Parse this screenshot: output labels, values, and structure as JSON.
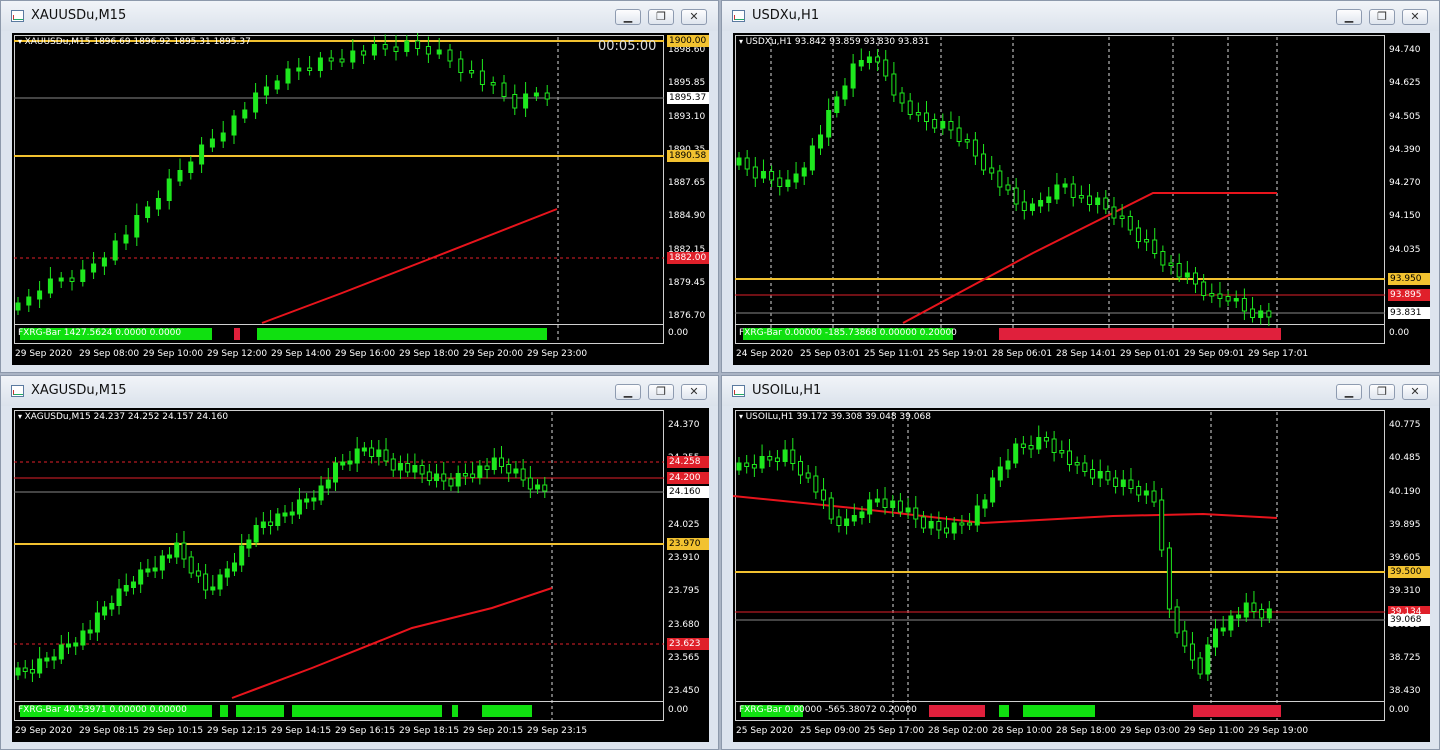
{
  "windows": [
    {
      "title": "XAUUSDu,M15",
      "info": "XAUUSDu,M15  1896.69 1896.92 1895.31 1895.37",
      "timer": "00:05:00",
      "prices": [
        "1898.60",
        "1895.85",
        "1893.10",
        "1890.35",
        "1887.65",
        "1884.90",
        "1882.15",
        "1879.45",
        "1876.70"
      ],
      "tags": [
        {
          "text": "1900.00",
          "bg": "#f2c230",
          "fg": "#000"
        },
        {
          "text": "1895.37",
          "bg": "#fff",
          "fg": "#000"
        },
        {
          "text": "1890.58",
          "bg": "#f2c230",
          "fg": "#000"
        },
        {
          "text": "1882.00",
          "bg": "#e0202a",
          "fg": "#fff"
        }
      ],
      "indicator": "FXRG-Bar 1427.5624 0.0000 0.0000",
      "ind_value": "0.00",
      "dates": [
        "29 Sep 2020",
        "29 Sep 08:00",
        "29 Sep 10:00",
        "29 Sep 12:00",
        "29 Sep 14:00",
        "29 Sep 16:00",
        "29 Sep 18:00",
        "29 Sep 20:00",
        "29 Sep 23:00"
      ]
    },
    {
      "title": "USDXu,H1",
      "info": "USDXu,H1  93.842 93.859 93.830 93.831",
      "prices": [
        "94.740",
        "94.625",
        "94.505",
        "94.390",
        "94.270",
        "94.150",
        "94.035",
        "93.915",
        "93.800"
      ],
      "tags": [
        {
          "text": "93.950",
          "bg": "#f2c230",
          "fg": "#000"
        },
        {
          "text": "93.895",
          "bg": "#e0202a",
          "fg": "#fff"
        },
        {
          "text": "93.831",
          "bg": "#fff",
          "fg": "#000"
        }
      ],
      "indicator": "FXRG-Bar 0.00000 -185.73868 0.00000 0.20000",
      "ind_value": "0.00",
      "dates": [
        "24 Sep 2020",
        "25 Sep 03:01",
        "25 Sep 11:01",
        "25 Sep 19:01",
        "28 Sep 06:01",
        "28 Sep 14:01",
        "29 Sep 01:01",
        "29 Sep 09:01",
        "29 Sep 17:01"
      ]
    },
    {
      "title": "XAGUSDu,M15",
      "info": "XAGUSDu,M15  24.237 24.252 24.157 24.160",
      "prices": [
        "24.370",
        "24.255",
        "24.140",
        "24.025",
        "23.910",
        "23.795",
        "23.680",
        "23.565",
        "23.450"
      ],
      "tags": [
        {
          "text": "24.258",
          "bg": "#e0202a",
          "fg": "#fff"
        },
        {
          "text": "24.200",
          "bg": "#e0202a",
          "fg": "#fff"
        },
        {
          "text": "24.160",
          "bg": "#fff",
          "fg": "#000"
        },
        {
          "text": "23.970",
          "bg": "#f2c230",
          "fg": "#000"
        },
        {
          "text": "23.623",
          "bg": "#e0202a",
          "fg": "#fff"
        }
      ],
      "indicator": "FXRG-Bar 40.53971 0.00000 0.00000",
      "ind_value": "0.00",
      "dates": [
        "29 Sep 2020",
        "29 Sep 08:15",
        "29 Sep 10:15",
        "29 Sep 12:15",
        "29 Sep 14:15",
        "29 Sep 16:15",
        "29 Sep 18:15",
        "29 Sep 20:15",
        "29 Sep 23:15"
      ]
    },
    {
      "title": "USOILu,H1",
      "info": "USOILu,H1  39.172 39.308 39.048 39.068",
      "prices": [
        "40.775",
        "40.485",
        "40.190",
        "39.895",
        "39.605",
        "39.310",
        "39.015",
        "38.725",
        "38.430"
      ],
      "tags": [
        {
          "text": "39.500",
          "bg": "#f2c230",
          "fg": "#000"
        },
        {
          "text": "39.134",
          "bg": "#e0202a",
          "fg": "#fff"
        },
        {
          "text": "39.068",
          "bg": "#fff",
          "fg": "#000"
        }
      ],
      "indicator": "FXRG-Bar 0.00000 -565.38072 0.20000",
      "ind_value": "0.00",
      "dates": [
        "25 Sep 2020",
        "25 Sep 09:00",
        "25 Sep 17:00",
        "28 Sep 02:00",
        "28 Sep 10:00",
        "28 Sep 18:00",
        "29 Sep 03:00",
        "29 Sep 11:00",
        "29 Sep 19:00"
      ]
    }
  ],
  "colors": {
    "bull": "#1ee81e",
    "bear": "#000",
    "wick": "#1ee81e",
    "ma": "#e8141c",
    "level": "#f2c230",
    "redlevel": "#e0202a",
    "ind_green": "#10e010",
    "ind_red": "#e0203c"
  }
}
